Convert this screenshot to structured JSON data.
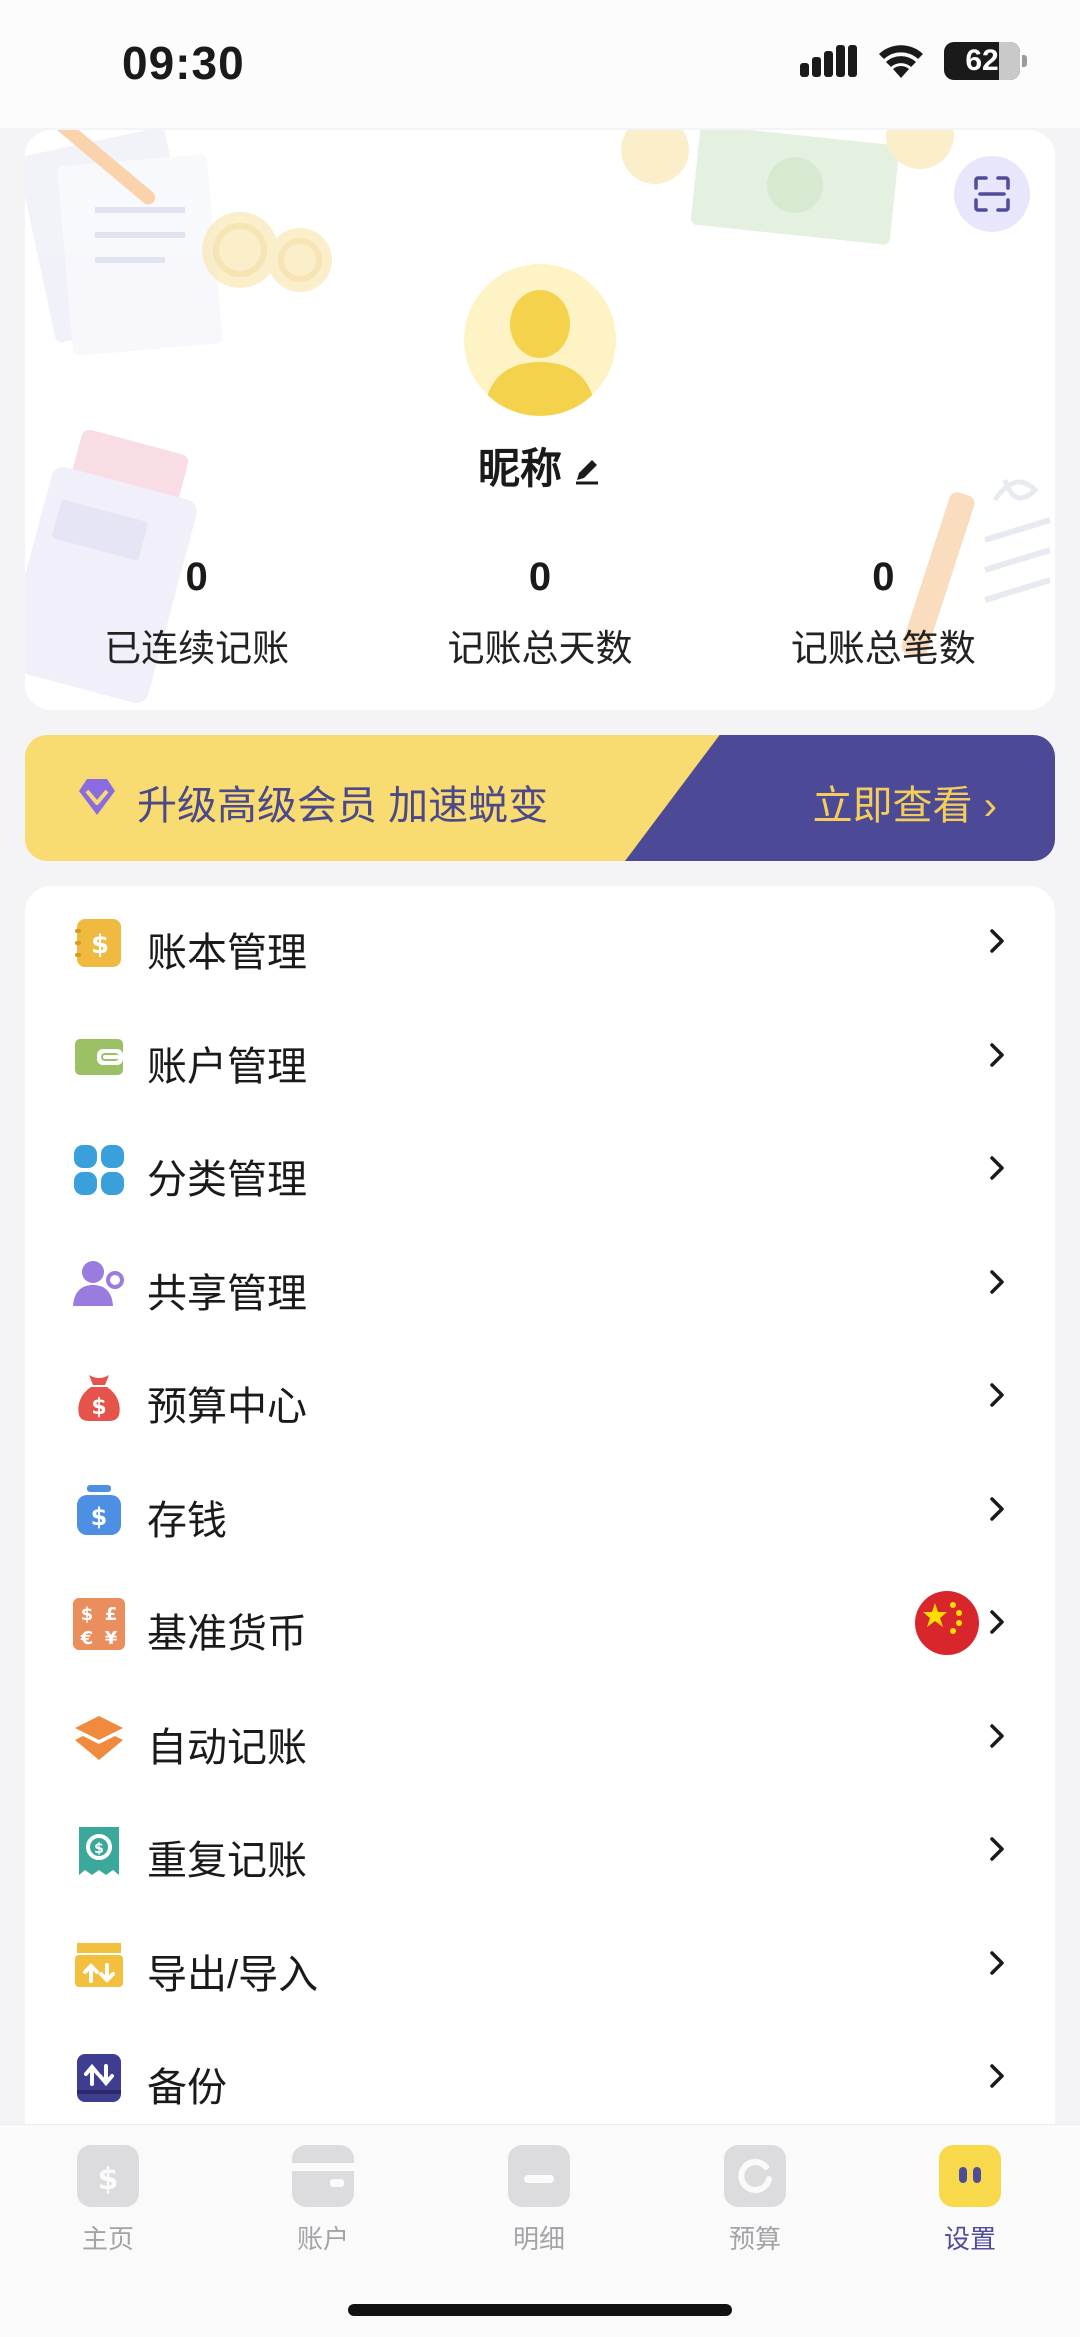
{
  "status_bar": {
    "time": "09:30",
    "battery": "62"
  },
  "profile": {
    "nickname": "昵称",
    "stats": [
      {
        "value": "0",
        "label": "已连续记账"
      },
      {
        "value": "0",
        "label": "记账总天数"
      },
      {
        "value": "0",
        "label": "记账总笔数"
      }
    ]
  },
  "vip_banner": {
    "text": "升级高级会员 加速蜕变",
    "cta": "立即查看 ›"
  },
  "menu": {
    "items": [
      {
        "label": "账本管理",
        "icon": "ledger-icon"
      },
      {
        "label": "账户管理",
        "icon": "wallet-icon"
      },
      {
        "label": "分类管理",
        "icon": "category-grid-icon"
      },
      {
        "label": "共享管理",
        "icon": "share-users-icon"
      },
      {
        "label": "预算中心",
        "icon": "money-bag-icon"
      },
      {
        "label": "存钱",
        "icon": "savings-jar-icon"
      },
      {
        "label": "基准货币",
        "icon": "currency-icon"
      },
      {
        "label": "自动记账",
        "icon": "layers-icon"
      },
      {
        "label": "重复记账",
        "icon": "repeat-receipt-icon"
      },
      {
        "label": "导出/导入",
        "icon": "export-import-box-icon"
      },
      {
        "label": "备份",
        "icon": "backup-drive-icon"
      }
    ]
  },
  "tab_bar": {
    "tabs": [
      {
        "label": "主页",
        "active": false
      },
      {
        "label": "账户",
        "active": false
      },
      {
        "label": "明细",
        "active": false
      },
      {
        "label": "预算",
        "active": false
      },
      {
        "label": "设置",
        "active": true
      }
    ]
  },
  "colors": {
    "accent": "#4c4a96",
    "vip_yellow": "#f8dc72",
    "active_tab": "#f8d94c"
  }
}
